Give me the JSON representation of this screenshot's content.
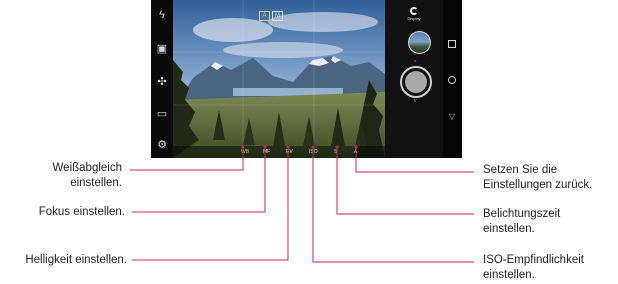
{
  "camera": {
    "mode_toggle": [
      "A",
      "M"
    ],
    "display_label": "Display",
    "manual_bar": {
      "items": [
        {
          "name": "white-balance",
          "text": "WB"
        },
        {
          "name": "focus",
          "text": "MF"
        },
        {
          "name": "brightness",
          "text": "EV"
        },
        {
          "name": "iso",
          "text": "ISO"
        },
        {
          "name": "shutter-speed",
          "text": "S"
        },
        {
          "name": "reset",
          "text": "A"
        }
      ]
    },
    "left_icons": [
      "flash-off-icon",
      "switch-camera-icon",
      "filter-icon",
      "mode-icon",
      "settings-icon"
    ]
  },
  "labels": {
    "white_balance": [
      "Weißabgleich",
      "einstellen."
    ],
    "focus": "Fokus einstellen.",
    "brightness": "Helligkeit einstellen.",
    "reset": [
      "Setzen Sie die",
      "Einstellungen zurück."
    ],
    "shutter_speed": [
      "Belichtungszeit",
      "einstellen."
    ],
    "iso": [
      "ISO-Empfindlichkeit",
      "einstellen."
    ]
  },
  "colors": {
    "callout_line": "#c7255a",
    "accent": "#e8c76a"
  }
}
